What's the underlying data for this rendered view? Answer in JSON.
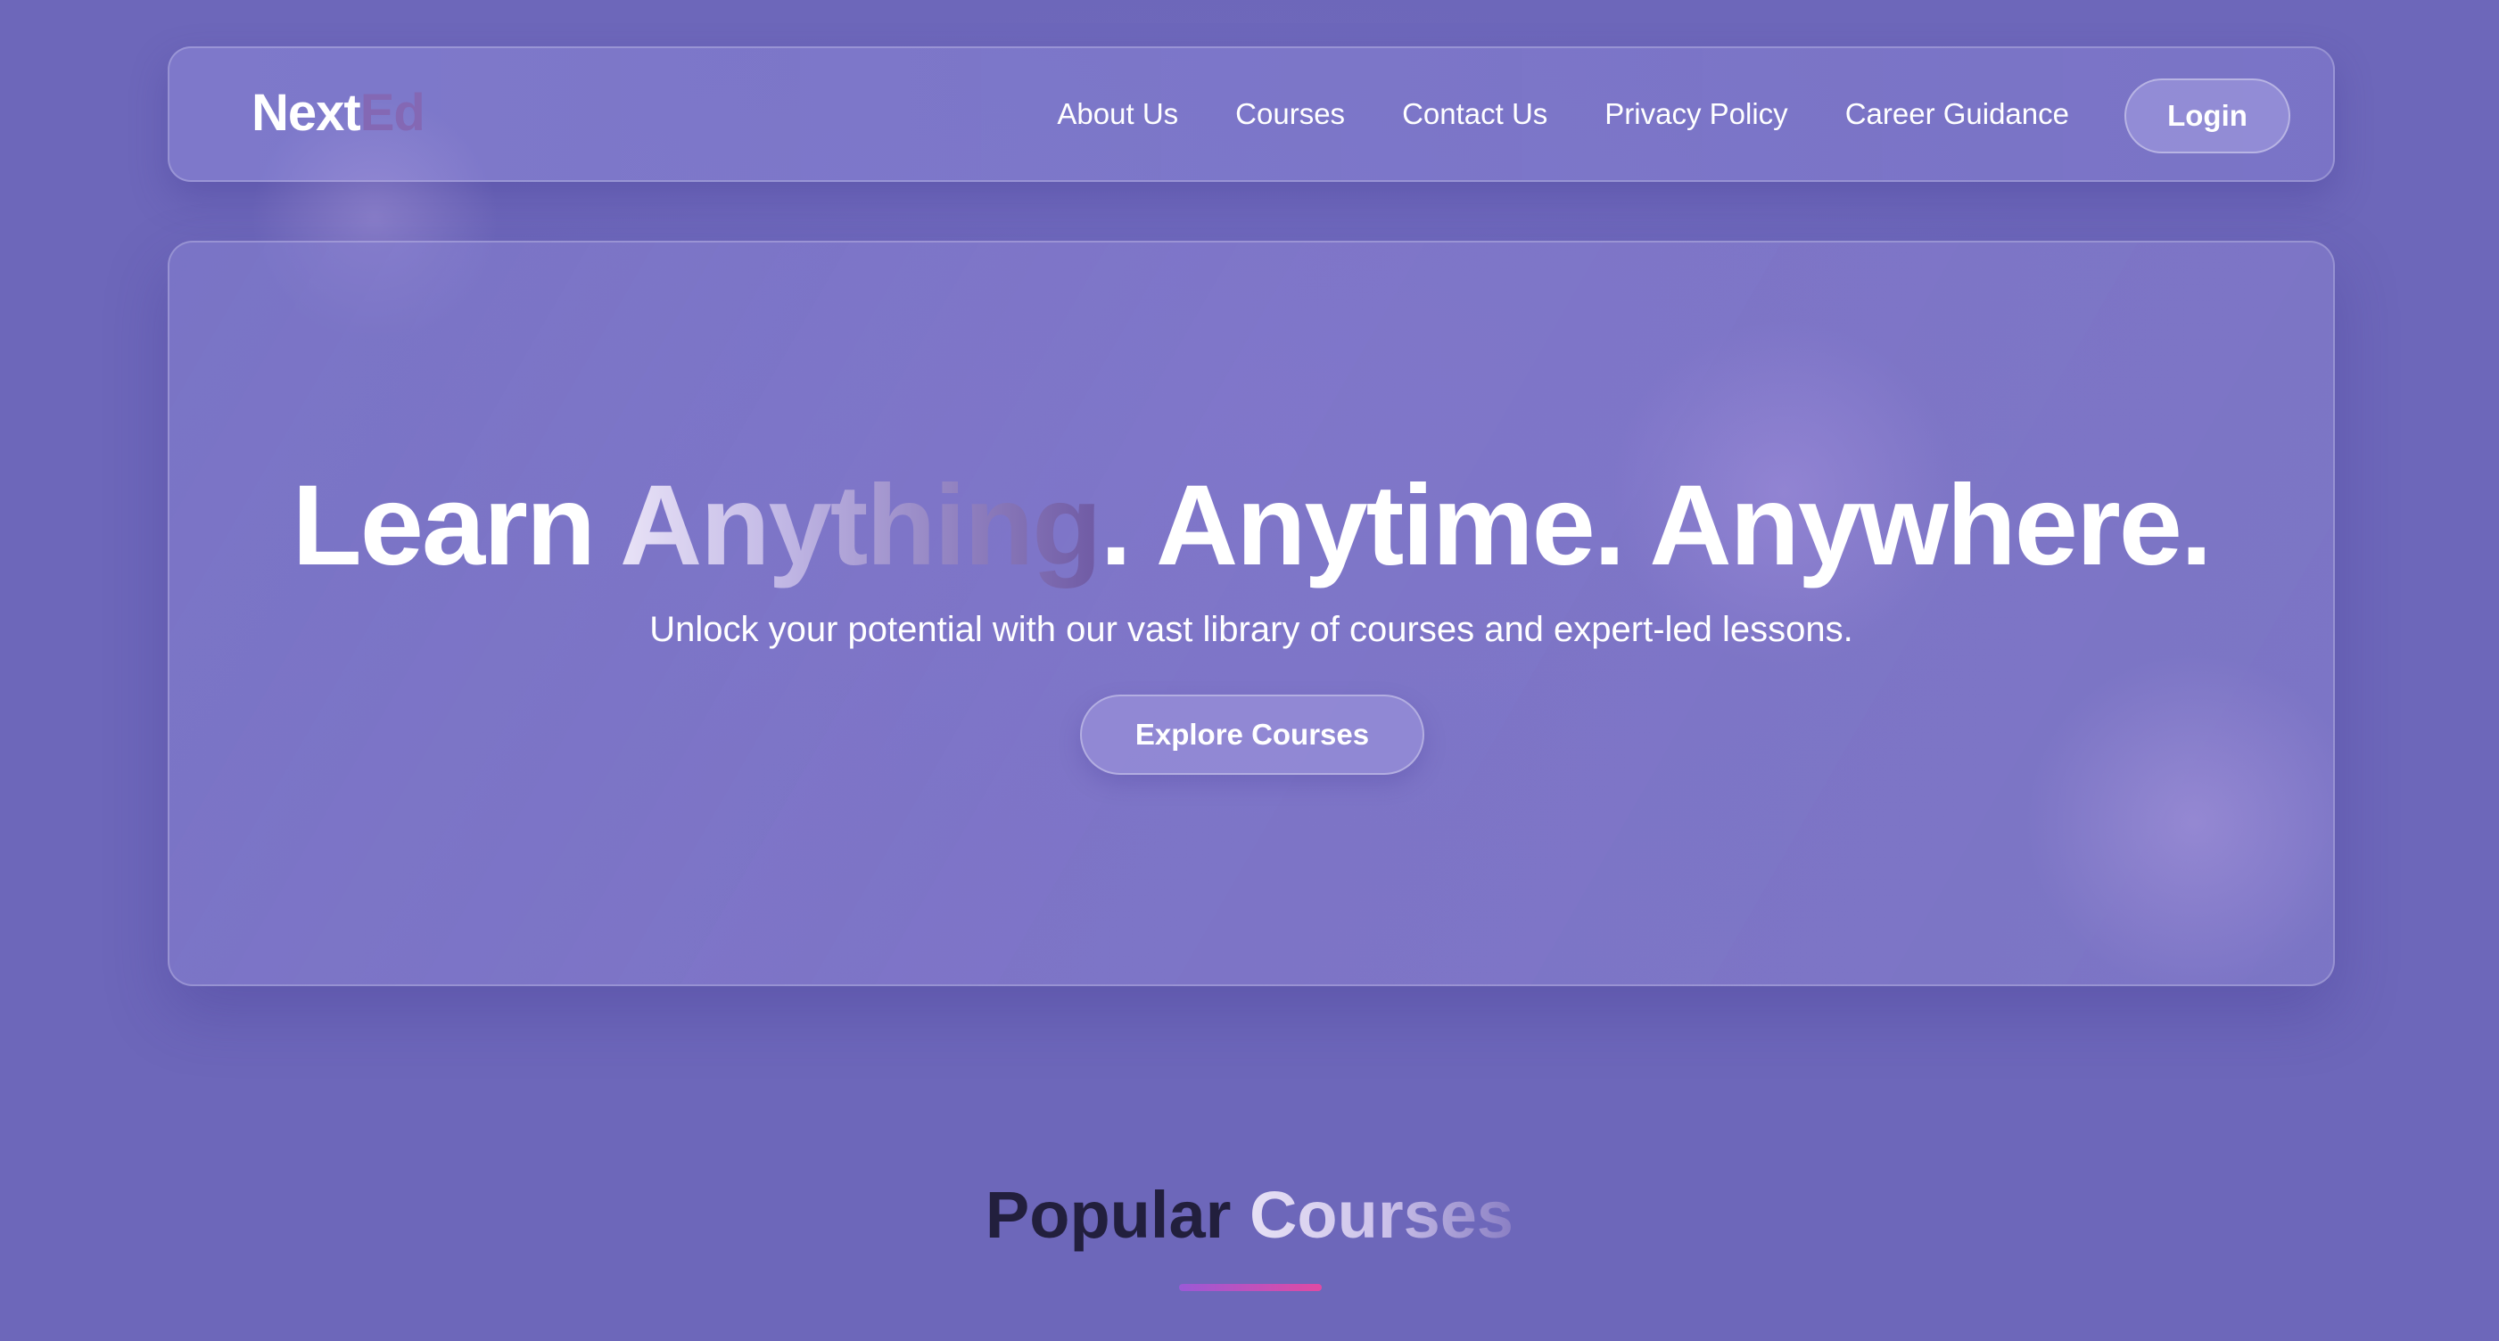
{
  "nav": {
    "logo_part1": "Next",
    "logo_part2": "Ed",
    "links": [
      "About Us",
      "Courses",
      "Contact Us",
      "Privacy Policy",
      "Career Guidance"
    ],
    "login_label": "Login"
  },
  "hero": {
    "title_start": "Learn ",
    "title_highlight": "Anything",
    "title_end": ". Anytime. Anywhere.",
    "subtitle": "Unlock your potential with our vast library of courses and expert-led lessons.",
    "cta_label": "Explore Courses"
  },
  "section": {
    "title_dark": "Popular ",
    "title_light": "Courses"
  },
  "colors": {
    "background": "#6d67ba",
    "accent_gradient_start": "#9b59d6",
    "accent_gradient_end": "#e04aa3",
    "logo_accent": "#8468b4",
    "heading_dark": "#221f3d"
  }
}
